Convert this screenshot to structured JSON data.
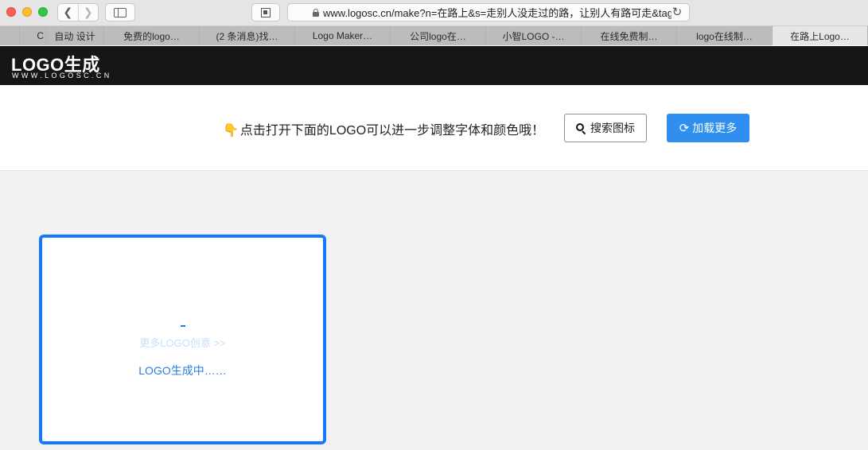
{
  "browser": {
    "url": "www.logosc.cn/make?n=在路上&s=走别人没走过的路，让别人有路可走&tag=",
    "tabs": [
      {
        "label": "C",
        "active": false
      },
      {
        "label": "自动 设计",
        "active": false
      },
      {
        "label": "免费的logo…",
        "active": false
      },
      {
        "label": "(2 条消息)找…",
        "active": false
      },
      {
        "label": "Logo Maker…",
        "active": false
      },
      {
        "label": "公司logo在…",
        "active": false
      },
      {
        "label": "小智LOGO -…",
        "active": false
      },
      {
        "label": "在线免费制…",
        "active": false
      },
      {
        "label": "logo在线制…",
        "active": false
      },
      {
        "label": "在路上Logo…",
        "active": true
      }
    ]
  },
  "site": {
    "logo_main": "LOGO生成",
    "logo_sub": "WWW.LOGOSC.CN"
  },
  "toolbar": {
    "hint_icon": "👇",
    "hint": "点击打开下面的LOGO可以进一步调整字体和颜色哦！",
    "search_label": "搜索图标",
    "load_more_label": "加载更多",
    "accent_color": "#2f8ff0"
  },
  "card": {
    "more_link": "更多LOGO创意 >>",
    "loading_text": "LOGO生成中……",
    "border_color": "#1677ff"
  }
}
